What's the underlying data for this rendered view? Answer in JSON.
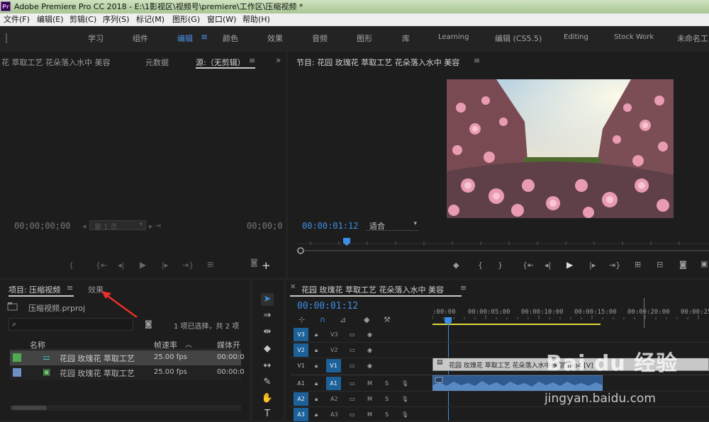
{
  "titlebar": {
    "app_icon": "Pr",
    "title": "Adobe Premiere Pro CC 2018 - E:\\1影视区\\视频号\\premiere\\工作区\\压缩视频 *"
  },
  "menubar": {
    "items": [
      "文件(F)",
      "编辑(E)",
      "剪辑(C)",
      "序列(S)",
      "标记(M)",
      "图形(G)",
      "窗口(W)",
      "帮助(H)"
    ]
  },
  "workspaces": {
    "items": [
      "学习",
      "组件",
      "编辑",
      "颜色",
      "效果",
      "音频",
      "图形",
      "库",
      "Learning",
      "编辑 (CS5.5)",
      "Editing",
      "Stock Work",
      "未命名工"
    ],
    "active": "编辑"
  },
  "source_panel": {
    "tab_clip": "花 萃取工艺 花朵落入水中 美容",
    "tab_metadata": "元数据",
    "tab_source": "源:（无剪辑）",
    "timecode_left": "00;00;00;00",
    "timecode_right": "00;00;0",
    "page_label": "第 1 页"
  },
  "program_panel": {
    "title": "节目: 花园 玫瑰花 萃取工艺 花朵落入水中 美容",
    "timecode": "00:00:01:12",
    "fit": "适合"
  },
  "project_panel": {
    "tab_project": "项目: 压缩视频",
    "tab_effects": "效果",
    "project_file": "压缩视频.prproj",
    "selection_info": "1 项已选择，共 2 项",
    "search_placeholder": "",
    "col_name": "名称",
    "col_fps": "帧速率",
    "col_media": "媒体开",
    "rows": [
      {
        "name": "花园 玫瑰花 萃取工艺",
        "fps": "25.00 fps",
        "media": "00:00:0",
        "color": "#4fa94f"
      },
      {
        "name": "花园 玫瑰花 萃取工艺",
        "fps": "25.00 fps",
        "media": "00:00:0",
        "color": "#6f8fc7"
      }
    ]
  },
  "timeline": {
    "title": "花园 玫瑰花 萃取工艺 花朵落入水中 美容",
    "timecode": "00:00:01:12",
    "ruler": [
      ":00:00",
      "00:00:05:00",
      "00:00:10:00",
      "00:00:15:00",
      "00:00:20:00",
      "00:00:25:0"
    ],
    "tracks": [
      {
        "id": "V3",
        "src": "",
        "tgt": "V3",
        "kind": "video"
      },
      {
        "id": "V2",
        "src": "",
        "tgt": "V2",
        "kind": "video"
      },
      {
        "id": "V1",
        "src": "V1",
        "tgt": "V1",
        "kind": "video"
      },
      {
        "id": "A1",
        "src": "A1",
        "tgt": "A1",
        "kind": "audio"
      },
      {
        "id": "A2",
        "src": "A2",
        "tgt": "A2",
        "kind": "audio"
      },
      {
        "id": "A3",
        "src": "A3",
        "tgt": "A3",
        "kind": "audio"
      }
    ],
    "clip_label": "花园 玫瑰花 萃取工艺 花朵落入水中 美容.mp4 [V]",
    "mute": "M",
    "solo": "S"
  },
  "watermark": {
    "brand": "Bai du 经验",
    "url": "jingyan.baidu.com"
  },
  "colors": {
    "accent": "#3c8fe8",
    "annotation_arrow": "#e8302a",
    "track_target": "#1d6198"
  }
}
